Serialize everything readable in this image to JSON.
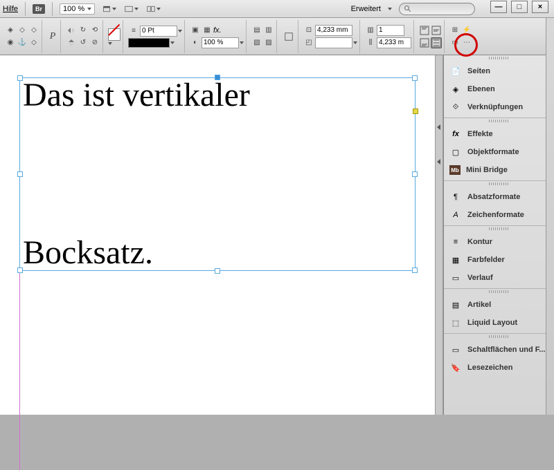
{
  "menubar": {
    "help": "Hilfe",
    "br": "Br",
    "zoom": "100 %",
    "workspace": "Erweitert"
  },
  "window_buttons": {
    "min": "—",
    "max": "□",
    "close": "×"
  },
  "toolbar": {
    "stroke_weight": "0 Pt",
    "opacity": "100 %",
    "measure_a": "4,233 mm",
    "columns": "1",
    "gutter": "4,233 m",
    "fx": "fx."
  },
  "canvas": {
    "line1": "Das ist vertikaler",
    "line2": "Bocksatz."
  },
  "panels": {
    "group1": [
      {
        "icon": "pages-icon",
        "label": "Seiten"
      },
      {
        "icon": "layers-icon",
        "label": "Ebenen"
      },
      {
        "icon": "links-icon",
        "label": "Verknüpfungen"
      }
    ],
    "group2": [
      {
        "icon": "fx-icon",
        "label": "Effekte"
      },
      {
        "icon": "objstyle-icon",
        "label": "Objektformate"
      },
      {
        "icon": "minibridge-icon",
        "label": "Mini Bridge"
      }
    ],
    "group3": [
      {
        "icon": "para-icon",
        "label": "Absatzformate"
      },
      {
        "icon": "char-icon",
        "label": "Zeichenformate"
      }
    ],
    "group4": [
      {
        "icon": "stroke-icon",
        "label": "Kontur"
      },
      {
        "icon": "swatches-icon",
        "label": "Farbfelder"
      },
      {
        "icon": "gradient-icon",
        "label": "Verlauf"
      }
    ],
    "group5": [
      {
        "icon": "article-icon",
        "label": "Artikel"
      },
      {
        "icon": "liquid-icon",
        "label": "Liquid Layout"
      }
    ],
    "group6": [
      {
        "icon": "buttons-icon",
        "label": "Schaltflächen und F..."
      },
      {
        "icon": "bookmark-icon",
        "label": "Lesezeichen"
      }
    ]
  }
}
